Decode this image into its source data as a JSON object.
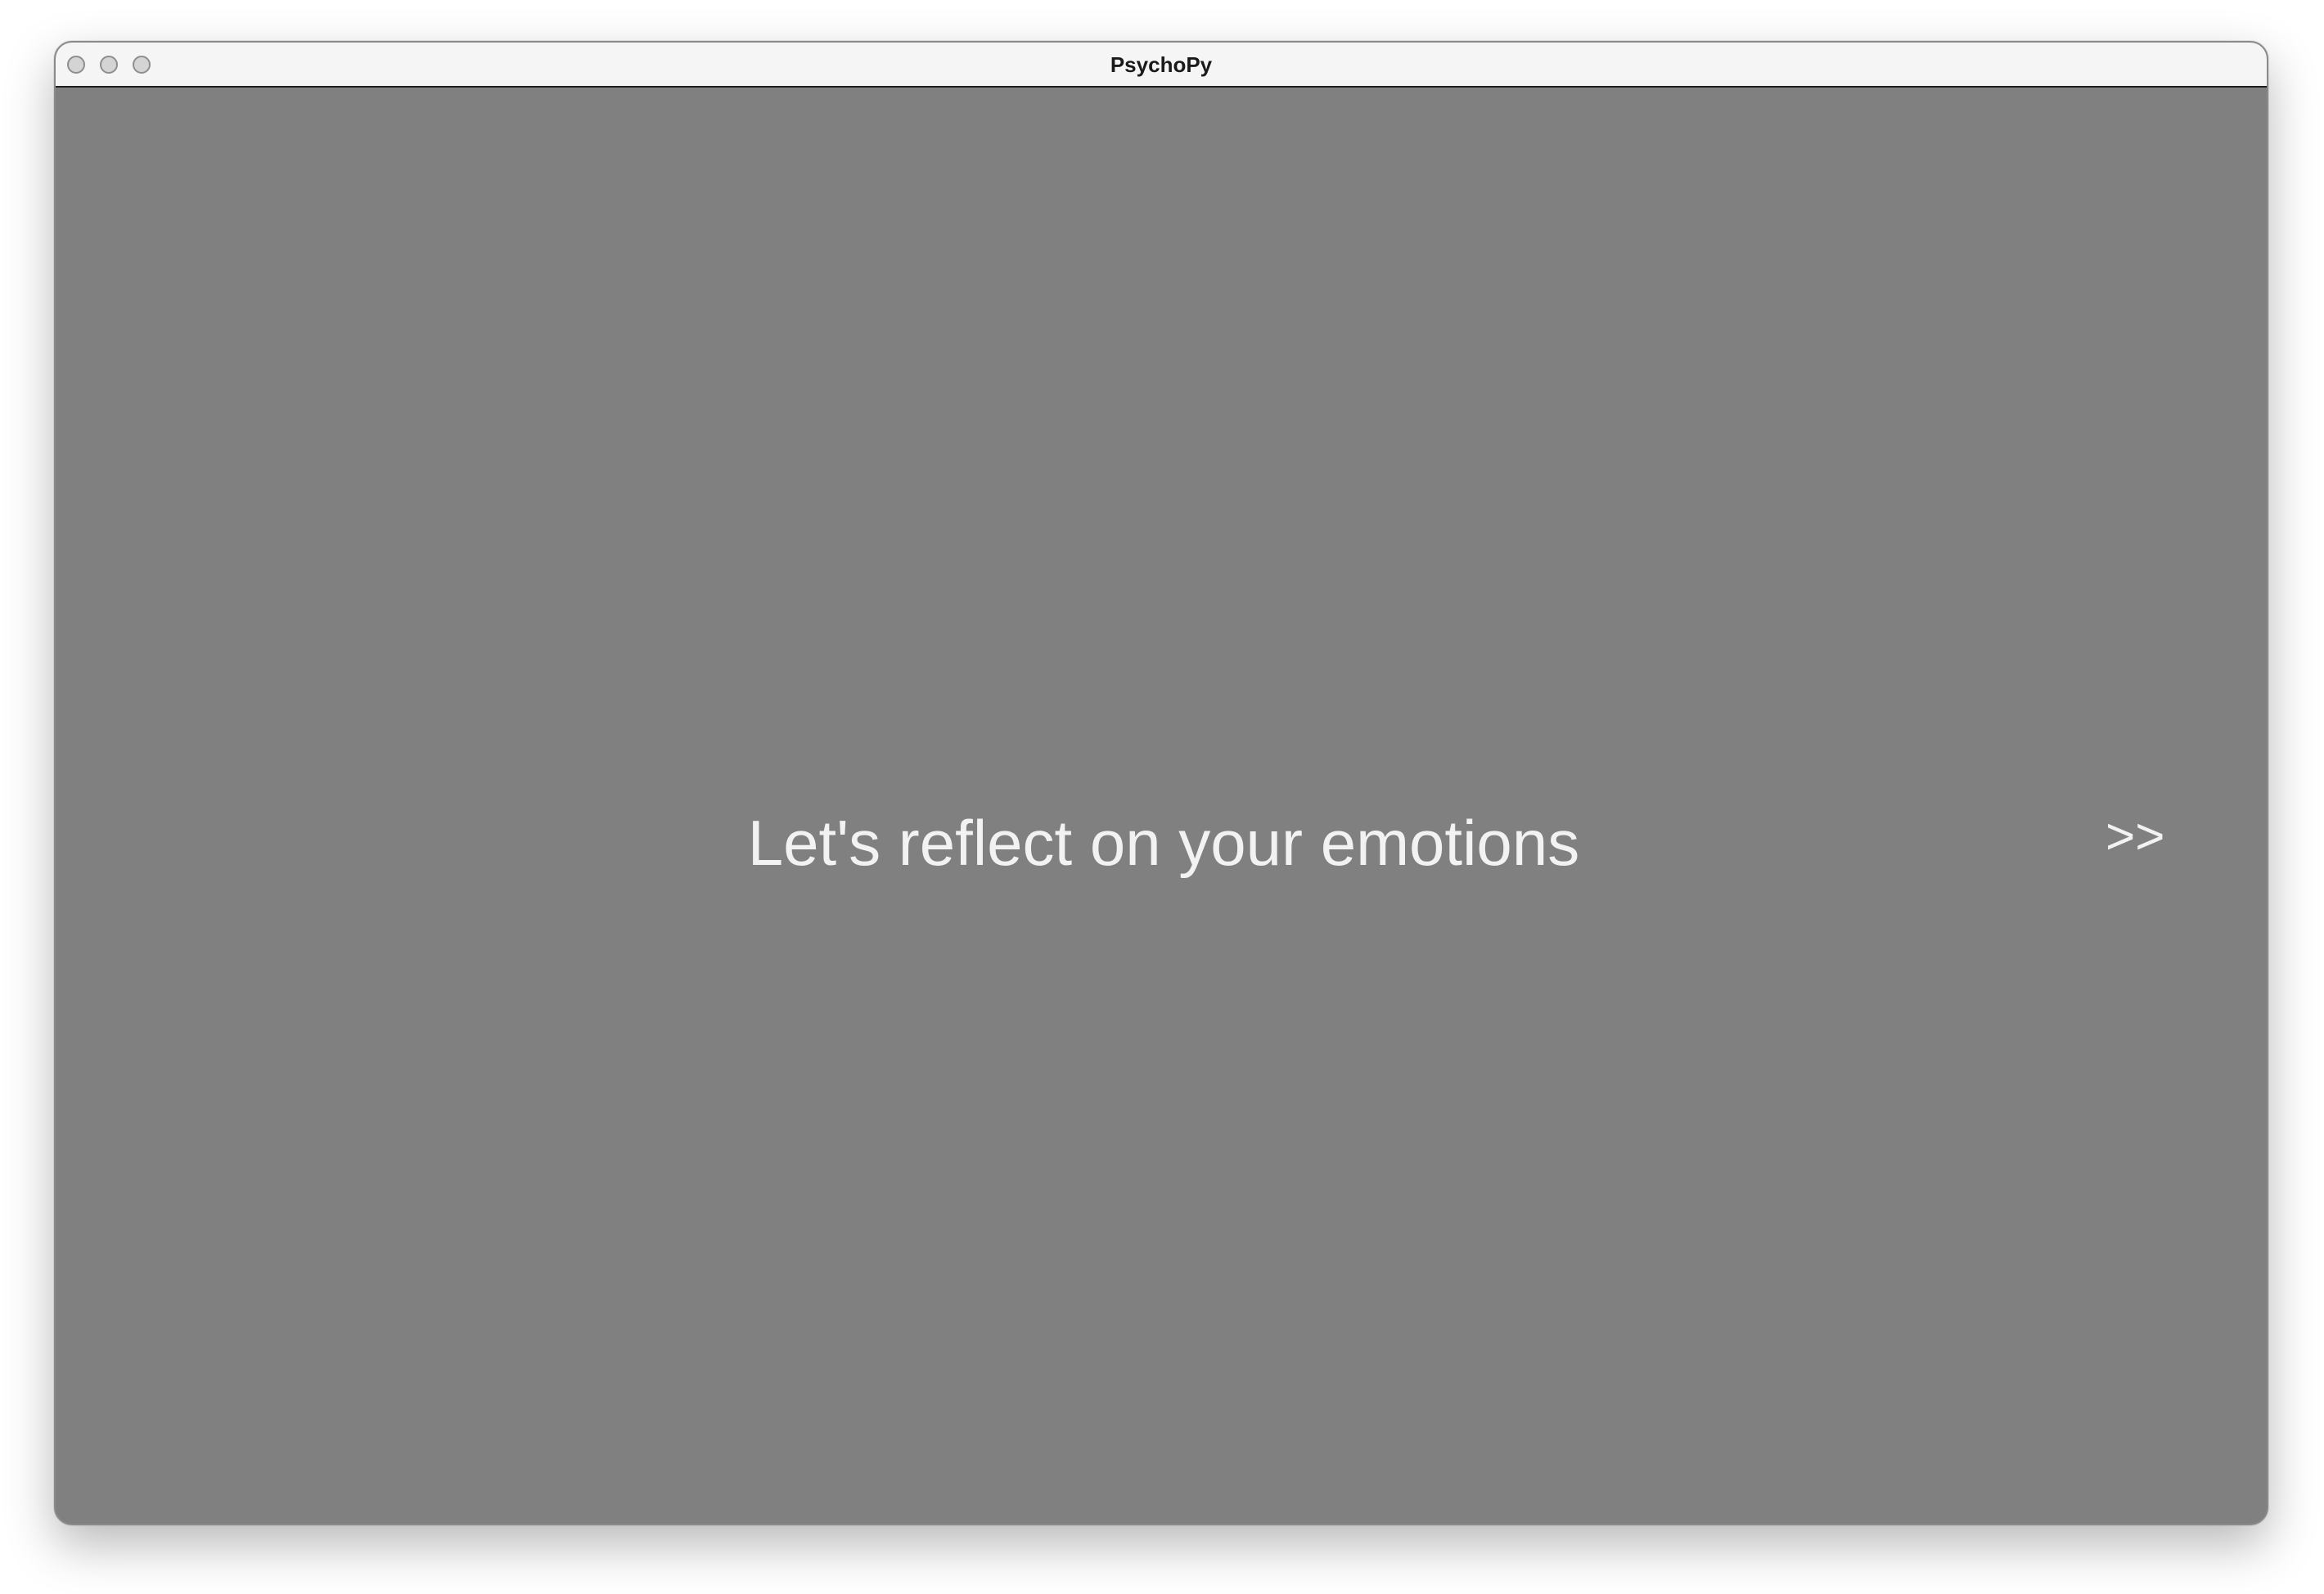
{
  "window": {
    "title": "PsychoPy",
    "background_color": "#808080",
    "controls": [
      "close-button",
      "minimize-button",
      "maximize-button"
    ]
  },
  "stimulus": {
    "prompt_text": "Let's reflect on your emotions",
    "next_label": ">>",
    "text_color": "#f2f2f2"
  }
}
